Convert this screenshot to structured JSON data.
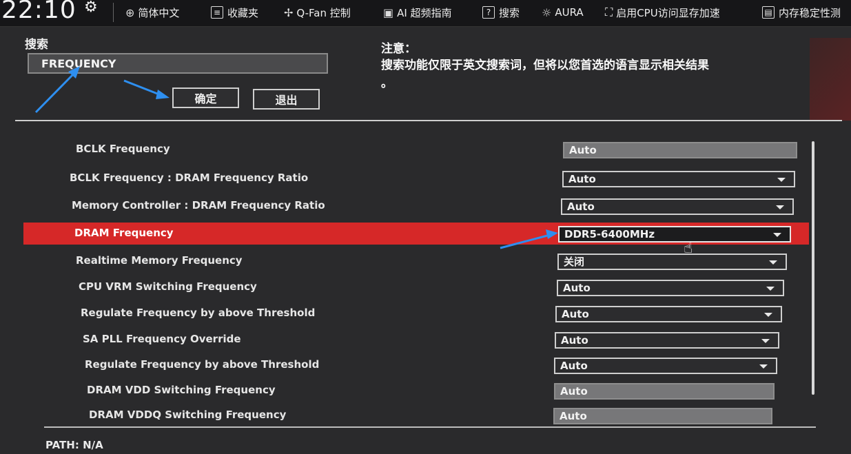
{
  "topbar": {
    "clock": "22:10",
    "items": [
      {
        "icon": "globe-icon",
        "label": "简体中文"
      },
      {
        "icon": "bookmark-icon",
        "label": "收藏夹"
      },
      {
        "icon": "fan-icon",
        "label": "Q-Fan 控制"
      },
      {
        "icon": "ai-chip-icon",
        "label": "AI 超频指南"
      },
      {
        "icon": "help-icon",
        "label": "搜索"
      },
      {
        "icon": "aura-light-icon",
        "label": "AURA"
      },
      {
        "icon": "resizable-bar-icon",
        "label": "启用CPU访问显存加速"
      },
      {
        "icon": "memory-icon",
        "label": "内存稳定性测"
      }
    ]
  },
  "search": {
    "label": "搜索",
    "value": "FREQUENCY",
    "ok_label": "确定",
    "exit_label": "退出"
  },
  "notice": {
    "title": "注意：",
    "text": "搜索功能仅限于英文搜索词，但将以您首选的语言显示相关结果",
    "tail": "。"
  },
  "settings": [
    {
      "label": "BCLK Frequency",
      "value": "Auto",
      "kind": "readonly"
    },
    {
      "label": "BCLK Frequency : DRAM Frequency Ratio",
      "value": "Auto",
      "kind": "dropdown"
    },
    {
      "label": "Memory Controller : DRAM Frequency Ratio",
      "value": "Auto",
      "kind": "dropdown"
    },
    {
      "label": "DRAM Frequency",
      "value": "DDR5-6400MHz",
      "kind": "dropdown",
      "selected": true
    },
    {
      "label": "Realtime Memory Frequency",
      "value": "关闭",
      "kind": "dropdown"
    },
    {
      "label": "CPU VRM Switching Frequency",
      "value": "Auto",
      "kind": "dropdown"
    },
    {
      "label": "Regulate Frequency by above Threshold",
      "value": "Auto",
      "kind": "dropdown"
    },
    {
      "label": "SA PLL Frequency Override",
      "value": "Auto",
      "kind": "dropdown"
    },
    {
      "label": "Regulate Frequency by above Threshold",
      "value": "Auto",
      "kind": "dropdown"
    },
    {
      "label": "DRAM VDD Switching Frequency",
      "value": "Auto",
      "kind": "readonly"
    },
    {
      "label": "DRAM VDDQ Switching Frequency",
      "value": "Auto",
      "kind": "readonly"
    }
  ],
  "footer": {
    "path": "PATH: N/A"
  },
  "colors": {
    "selected_row": "#d62828",
    "background": "#2a2a2c",
    "annotation_arrow": "#2e8ff0"
  }
}
